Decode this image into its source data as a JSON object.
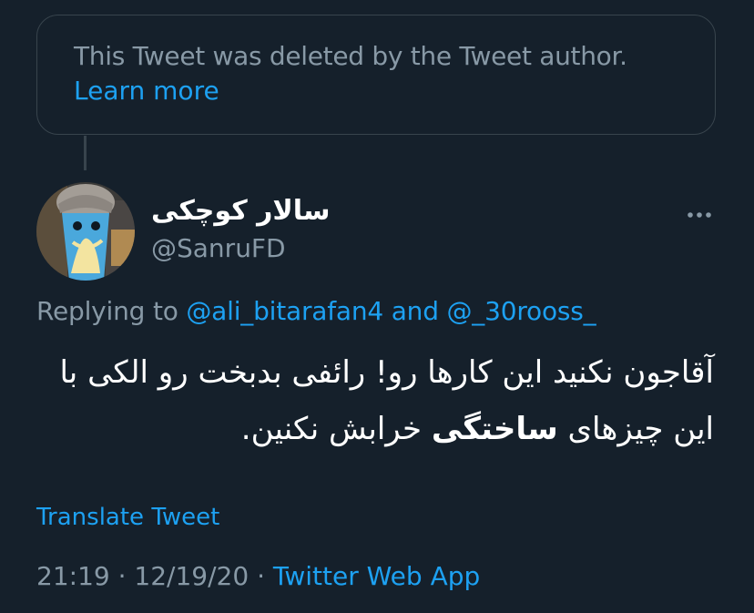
{
  "deleted_notice": {
    "text": "This Tweet was deleted by the Tweet author.",
    "learn_more": "Learn more"
  },
  "tweet": {
    "display_name": "سالار کوچکی",
    "handle": "@SanruFD",
    "more_icon": "more-horizontal-icon",
    "replying": {
      "prefix": "Replying to ",
      "mention_1": "@ali_bitarafan4",
      "joiner": " and ",
      "mention_2": "@_30rooss_"
    },
    "text_before_bold": "آقاجون نکنید این کارها رو! رائفی بدبخت رو الکی با این چیزهای ",
    "text_bold": "ساختگی",
    "text_after_bold": " خرابش نکنین.",
    "translate_label": "Translate Tweet",
    "time": "21:19",
    "sep_1": " · ",
    "date": "12/19/20",
    "sep_2": " · ",
    "source": "Twitter Web App"
  },
  "colors": {
    "background": "#15202b",
    "accent": "#1da1f2",
    "secondary_text": "#8899a6",
    "border": "#38444d"
  }
}
